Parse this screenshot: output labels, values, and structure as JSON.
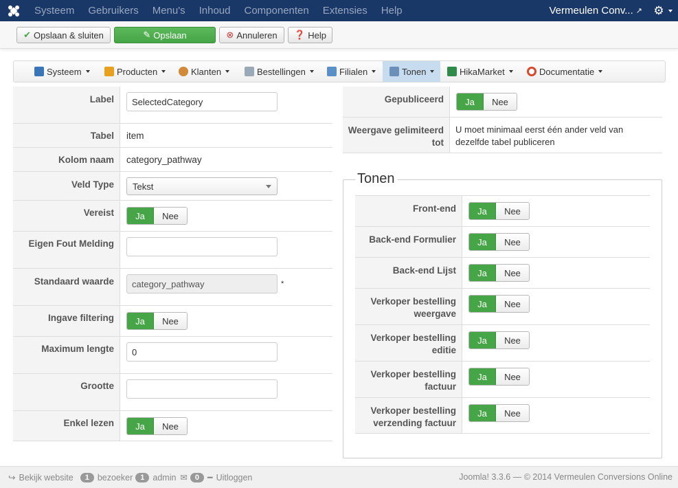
{
  "topbar": {
    "menu": [
      "Systeem",
      "Gebruikers",
      "Menu's",
      "Inhoud",
      "Componenten",
      "Extensies",
      "Help"
    ],
    "site_name": "Vermeulen Conv...",
    "logo_icon": "joomla-logo-icon",
    "gear_icon": "gear-icon"
  },
  "toolbar": {
    "save_close": "Opslaan & sluiten",
    "save": "Opslaan",
    "cancel": "Annuleren",
    "help": "Help"
  },
  "hikamenu": {
    "items": [
      {
        "label": "Systeem",
        "icon": "wrench-icon"
      },
      {
        "label": "Producten",
        "icon": "box-icon"
      },
      {
        "label": "Klanten",
        "icon": "users-icon"
      },
      {
        "label": "Bestellingen",
        "icon": "orders-icon"
      },
      {
        "label": "Filialen",
        "icon": "affiliates-icon"
      },
      {
        "label": "Tonen",
        "icon": "display-icon"
      },
      {
        "label": "HikaMarket",
        "icon": "hikamarket-icon"
      },
      {
        "label": "Documentatie",
        "icon": "help-ring-icon"
      }
    ],
    "active": "Tonen"
  },
  "form": {
    "label": {
      "label": "Label",
      "value": "SelectedCategory"
    },
    "table": {
      "label": "Tabel",
      "value": "item"
    },
    "column": {
      "label": "Kolom naam",
      "value": "category_pathway"
    },
    "fieldtype": {
      "label": "Veld Type",
      "value": "Tekst"
    },
    "required": {
      "label": "Vereist"
    },
    "custom_error": {
      "label": "Eigen Fout Melding",
      "value": ""
    },
    "default_value": {
      "label": "Standaard waarde",
      "value": "category_pathway",
      "marker": "*"
    },
    "input_filtering": {
      "label": "Ingave filtering"
    },
    "max_length": {
      "label": "Maximum lengte",
      "value": "0"
    },
    "size": {
      "label": "Grootte",
      "value": ""
    },
    "readonly": {
      "label": "Enkel lezen"
    }
  },
  "toggle": {
    "yes": "Ja",
    "no": "Nee"
  },
  "right": {
    "published": {
      "label": "Gepubliceerd"
    },
    "limited": {
      "label": "Weergave gelimiteerd tot",
      "value": "U moet minimaal eerst één ander veld van dezelfde tabel publiceren"
    }
  },
  "display": {
    "legend": "Tonen",
    "rows": [
      {
        "label": "Front-end"
      },
      {
        "label": "Back-end Formulier"
      },
      {
        "label": "Back-end Lijst"
      },
      {
        "label": "Verkoper bestelling weergave"
      },
      {
        "label": "Verkoper bestelling editie"
      },
      {
        "label": "Verkoper bestelling factuur"
      },
      {
        "label": "Verkoper bestelling verzending factuur"
      }
    ]
  },
  "footer": {
    "view_site": "Bekijk website",
    "visitors_count": "1",
    "visitors_label": "bezoeker",
    "admin_count": "1",
    "admin_label": "admin",
    "messages_count": "0",
    "logout": "Uitloggen",
    "version": "Joomla! 3.3.6",
    "copyright": "— © 2014 Vermeulen Conversions Online"
  }
}
